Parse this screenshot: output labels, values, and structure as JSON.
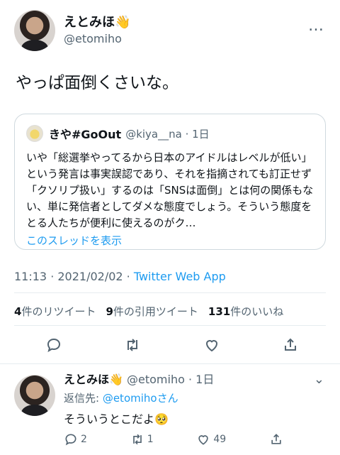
{
  "tweet": {
    "author_name": "えとみほ👋",
    "author_handle": "@etomiho",
    "more_label": "…",
    "text": "やっぱ面倒くさいな。",
    "quote": {
      "name": "きや#GoOut",
      "handle_meta": "@kiya__na · 1日",
      "body": "いや「総選挙やってるから日本のアイドルはレベルが低い」という発言は事実誤認であり、それを指摘されても訂正せず「クソリプ扱い」するのは「SNSは面倒」とは何の関係もない、単に発信者としてダメな態度でしょう。そういう態度をとる人たちが便利に使えるのがク…",
      "thread_link": "このスレッドを表示"
    },
    "time": "11:13 · 2021/02/02 · ",
    "app": "Twitter Web App",
    "stats": {
      "retweets_count": "4",
      "retweets_label": "件のリツイート",
      "quotes_count": "9",
      "quotes_label": "件の引用ツイート",
      "likes_count": "131",
      "likes_label": "件のいいね"
    }
  },
  "reply": {
    "name": "えとみほ👋",
    "handle_meta": " @etomiho · 1日",
    "reply_to_prefix": "返信先: ",
    "reply_to_mention": "@etomihoさん",
    "text": "そういうとこだよ🥺",
    "reply_count": "2",
    "retweet_count": "1",
    "like_count": "49",
    "more_label": "⌄"
  },
  "icons": {
    "accent": "#1d9bf0",
    "muted": "#536471"
  }
}
